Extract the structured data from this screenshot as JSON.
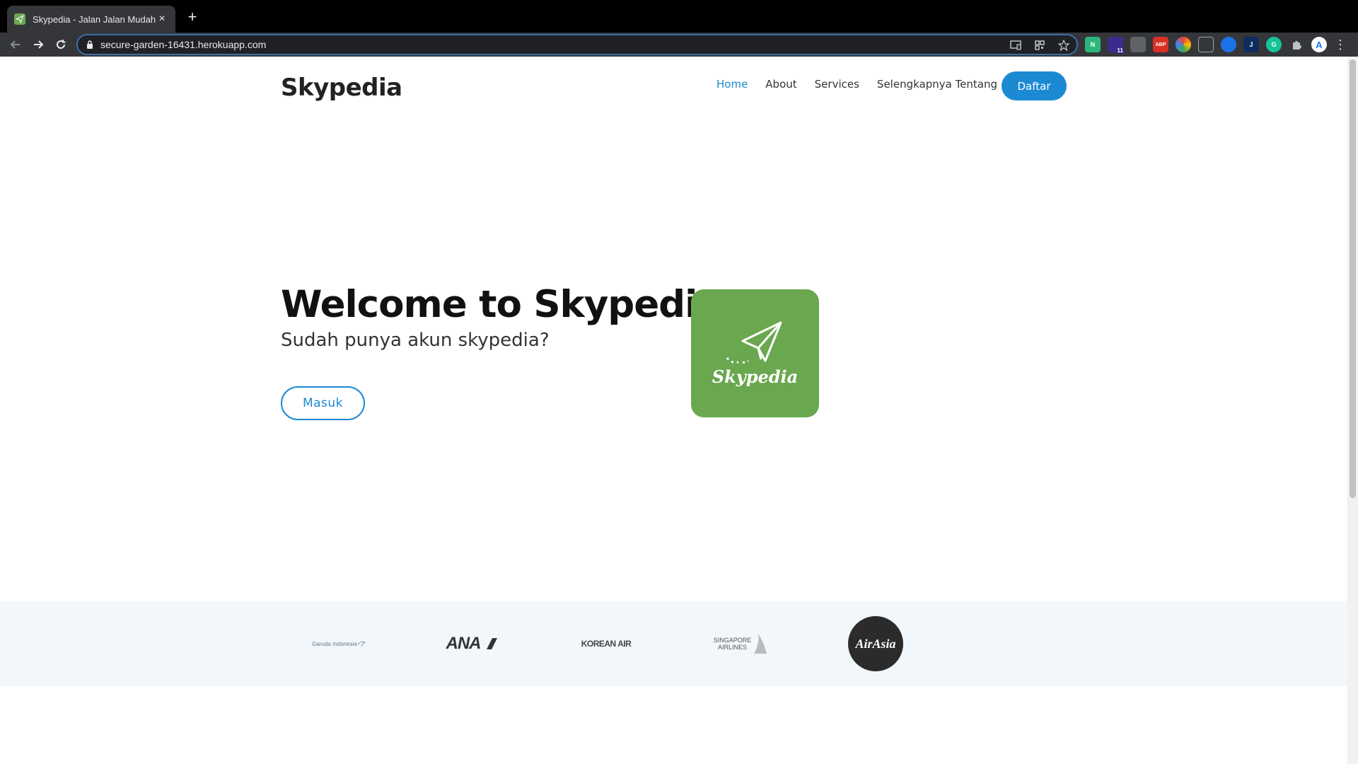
{
  "browser": {
    "tab_title": "Skypedia - Jalan Jalan Mudah",
    "tab_close": "×",
    "new_tab": "+",
    "url": "secure-garden-16431.herokuapp.com",
    "extension_badge": "11",
    "abp_label": "ABP",
    "profile_initial": "A",
    "menu": "⋮"
  },
  "header": {
    "brand": "Skypedia",
    "nav": [
      {
        "label": "Home",
        "active": true
      },
      {
        "label": "About"
      },
      {
        "label": "Services"
      },
      {
        "label": "Selengkapnya Tentang"
      }
    ],
    "cta_label": "Daftar"
  },
  "hero": {
    "title": "Welcome to Skypedia",
    "subtitle": "Sudah punya akun skypedia?",
    "login_label": "Masuk",
    "logo_text": "Skypedia",
    "logo_color": "#6aa84f"
  },
  "partners": {
    "garuda": "Garuda Indonesia",
    "ana": "ANA",
    "korean": "KOREAN AIR",
    "singapore_line1": "SINGAPORE",
    "singapore_line2": "AIRLINES",
    "airasia": "AirAsia"
  },
  "colors": {
    "accent": "#1b8ad3",
    "partner_band": "#f1f7fb"
  }
}
